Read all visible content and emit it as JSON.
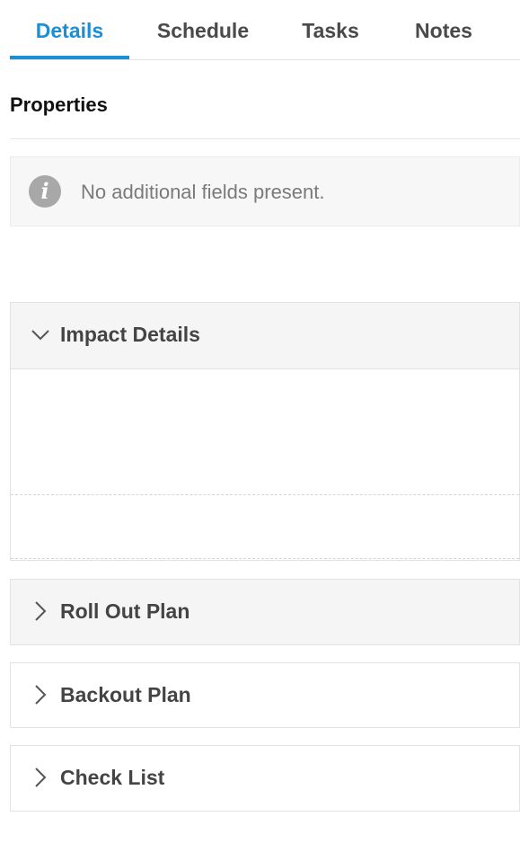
{
  "tabs": [
    {
      "label": "Details",
      "active": true
    },
    {
      "label": "Schedule",
      "active": false
    },
    {
      "label": "Tasks",
      "active": false
    },
    {
      "label": "Notes",
      "active": false
    }
  ],
  "properties": {
    "title": "Properties",
    "info_message": "No additional fields present.",
    "info_icon": "info-icon"
  },
  "panels": {
    "impact": {
      "title": "Impact Details",
      "expanded": true,
      "icon": "chevron-down-icon"
    },
    "rollout": {
      "title": "Roll Out Plan",
      "expanded": false,
      "icon": "chevron-right-icon"
    },
    "backout": {
      "title": "Backout Plan",
      "expanded": false,
      "icon": "chevron-right-icon"
    },
    "checklist": {
      "title": "Check List",
      "expanded": false,
      "icon": "chevron-right-icon"
    }
  },
  "colors": {
    "accent": "#1a8fd6",
    "tab_text": "#4a4a4a",
    "muted_text": "#7a7a7a",
    "panel_header_bg": "#f5f5f5"
  }
}
